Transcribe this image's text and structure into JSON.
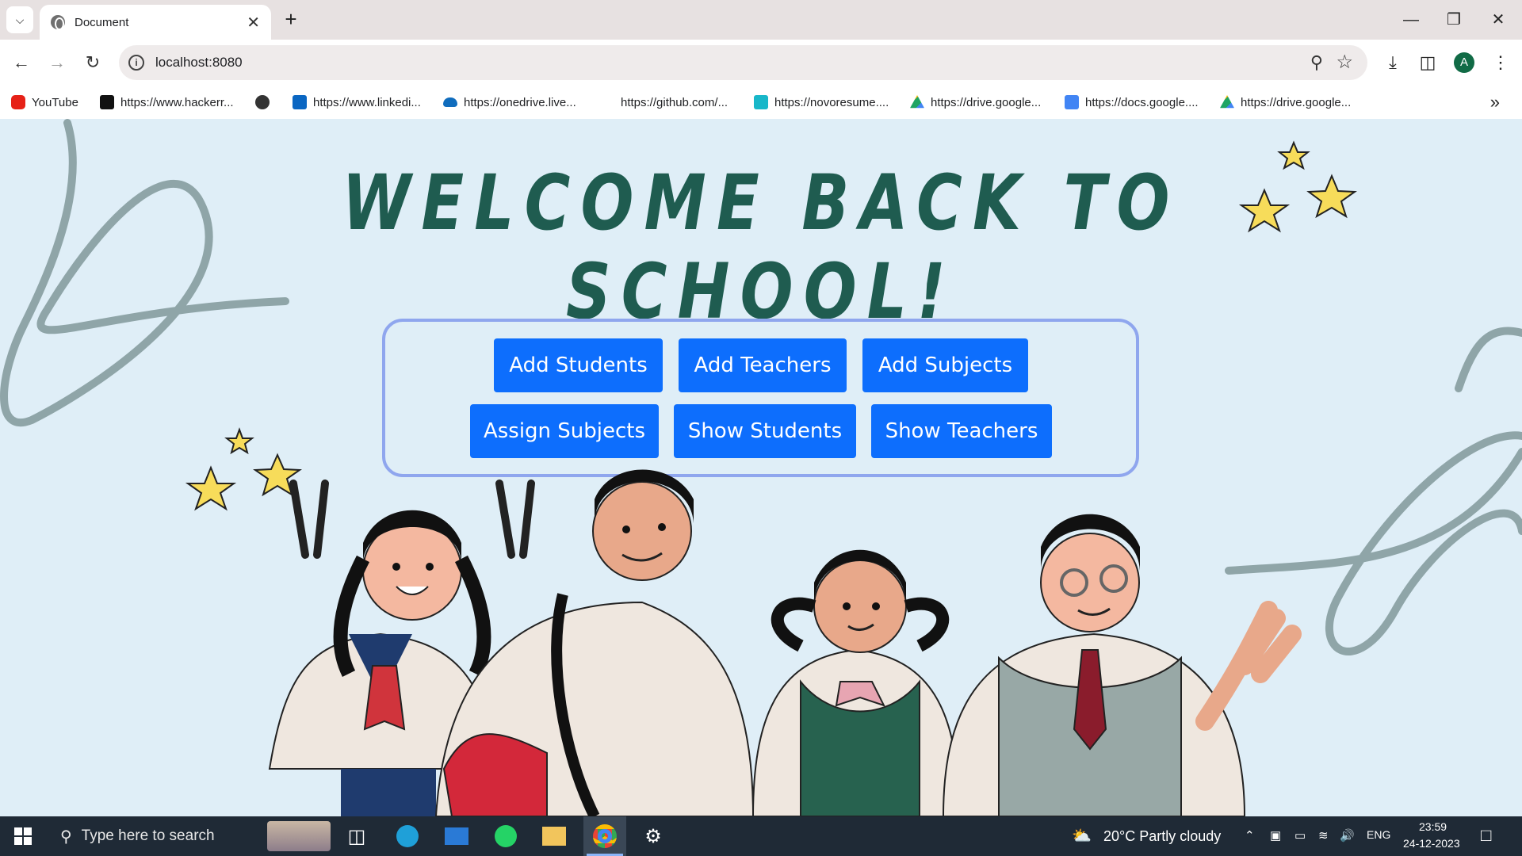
{
  "browser": {
    "tab_title": "Document",
    "url": "localhost:8080",
    "profile_initial": "A"
  },
  "bookmarks": [
    {
      "label": "YouTube",
      "icon": "youtube-icon",
      "color": "#e62117"
    },
    {
      "label": "https://www.hackerr...",
      "icon": "hackerrank-icon",
      "color": "#111111"
    },
    {
      "label": "",
      "icon": "globe-icon",
      "color": "#333333"
    },
    {
      "label": "https://www.linkedi...",
      "icon": "linkedin-icon",
      "color": "#0a66c2"
    },
    {
      "label": "https://onedrive.live...",
      "icon": "onedrive-icon",
      "color": "#0f6cbd"
    },
    {
      "label": "https://github.com/...",
      "icon": "github-icon",
      "color": "#ffffff"
    },
    {
      "label": "https://novoresume....",
      "icon": "novoresume-icon",
      "color": "#18b7c9"
    },
    {
      "label": "https://drive.google...",
      "icon": "drive-icon",
      "color": "#1fa463"
    },
    {
      "label": "https://docs.google....",
      "icon": "docs-icon",
      "color": "#4285f4"
    },
    {
      "label": "https://drive.google...",
      "icon": "drive-icon",
      "color": "#1fa463"
    }
  ],
  "page": {
    "title": "WELCOME BACK TO SCHOOL!",
    "colors": {
      "background": "#dfeef7",
      "title": "#1f5c50",
      "button": "#0d6efd",
      "panel_border": "#8fa6ee"
    },
    "buttons_row1": [
      "Add Students",
      "Add Teachers",
      "Add Subjects"
    ],
    "buttons_row2": [
      "Assign Subjects",
      "Show Students",
      "Show Teachers"
    ]
  },
  "taskbar": {
    "search_placeholder": "Type here to search",
    "weather": "20°C  Partly cloudy",
    "language": "ENG",
    "time": "23:59",
    "date": "24-12-2023"
  }
}
